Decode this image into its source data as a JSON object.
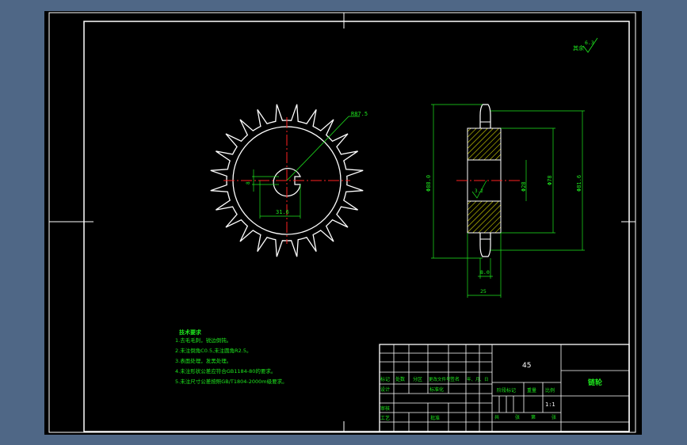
{
  "colors": {
    "background_app": "#4f6786",
    "canvas": "#000000",
    "outline": "#ffffff",
    "dimension": "#1ee81e",
    "centerline": "#ff0000",
    "hatch": "#ffff00"
  },
  "front_view": {
    "teeth_count": 24,
    "dim_pitch_circle": "R87.5",
    "dim_keyway_width": "8",
    "dim_hub_offset": "31.6"
  },
  "side_view": {
    "dim_outer_diameter": "Φ88.0",
    "dim_root_diameter": "Φ81.6",
    "dim_hub_diameter": "Φ78",
    "dim_bore": "Φ28",
    "dim_roughness_small": "3.2",
    "dim_tooth_width": "8.0",
    "dim_total_width": "25"
  },
  "surface_finish": {
    "label": "其余",
    "value": "6.3"
  },
  "tech_requirements": {
    "title": "技术要求",
    "items": [
      "1.去毛毛刺，锐边倒钝。",
      "2.未注倒角C0.5,未注圆角R2.5。",
      "3.表面处理，发黑处理。",
      "4.未注形状公差应符合GB1184-80的要求。",
      "5.未注尺寸公差按照GB/T1804-2000m级要求。"
    ]
  },
  "title_block": {
    "material": "45",
    "part_name": "链轮",
    "scale": "1:1",
    "headers": [
      "标记",
      "处数",
      "分区",
      "更改文件号",
      "签名",
      "年、月、日"
    ],
    "row_design": "设计",
    "row_standardize": "标准化",
    "stage_label": "阶段标记",
    "weight_label": "重量",
    "scale_label": "比例",
    "row_review": "审核",
    "row_process": "工艺",
    "approve_label": "批准",
    "sheet_total": "共",
    "sheet_label": "张",
    "sheet_num": "第",
    "sheet_label2": "张"
  }
}
